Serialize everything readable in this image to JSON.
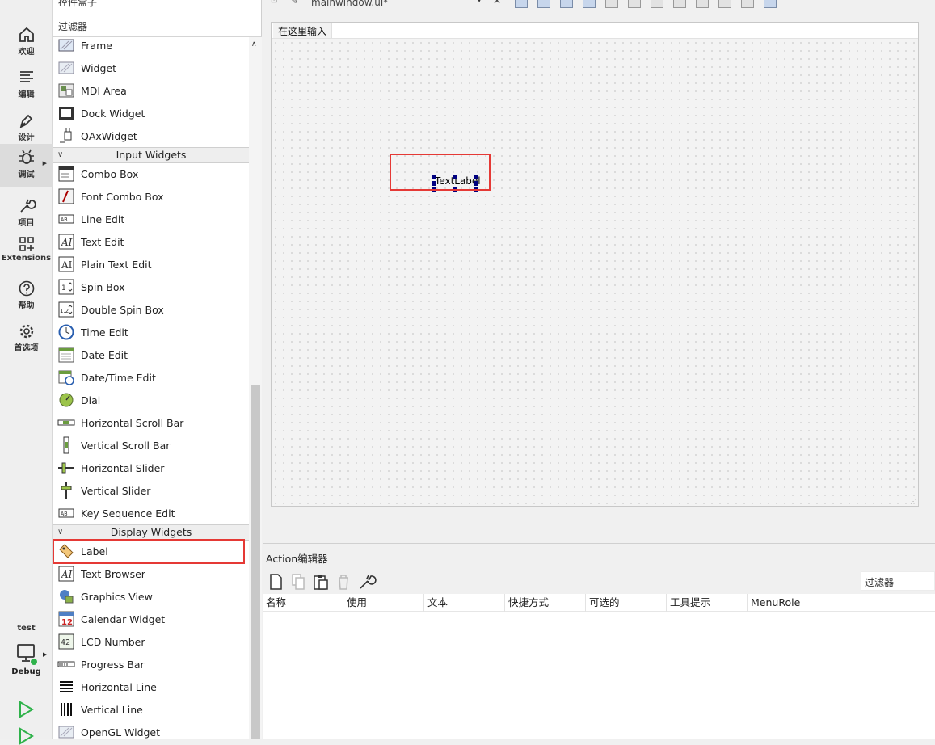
{
  "modebar": {
    "items": [
      {
        "label": "欢迎",
        "icon": "home-icon"
      },
      {
        "label": "编辑",
        "icon": "edit-lines-icon"
      },
      {
        "label": "设计",
        "icon": "pen-icon"
      },
      {
        "label": "调试",
        "icon": "bug-icon",
        "active": true
      },
      {
        "label": "项目",
        "icon": "wrench-icon"
      },
      {
        "label": "Extensions",
        "icon": "extensions-icon"
      },
      {
        "label": "帮助",
        "icon": "help-icon"
      },
      {
        "label": "首选项",
        "icon": "gear-icon"
      }
    ],
    "kit_name": "test",
    "build_config": "Debug"
  },
  "widgetbox": {
    "title": "控件盒子",
    "filter_placeholder": "过滤器",
    "top_items": [
      "Frame",
      "Widget",
      "MDI Area",
      "Dock Widget",
      "QAxWidget"
    ],
    "input_category": "Input Widgets",
    "input_items": [
      "Combo Box",
      "Font Combo Box",
      "Line Edit",
      "Text Edit",
      "Plain Text Edit",
      "Spin Box",
      "Double Spin Box",
      "Time Edit",
      "Date Edit",
      "Date/Time Edit",
      "Dial",
      "Horizontal Scroll Bar",
      "Vertical Scroll Bar",
      "Horizontal Slider",
      "Vertical Slider",
      "Key Sequence Edit"
    ],
    "display_category": "Display Widgets",
    "display_items": [
      "Label",
      "Text Browser",
      "Graphics View",
      "Calendar Widget",
      "LCD Number",
      "Progress Bar",
      "Horizontal Line",
      "Vertical Line",
      "OpenGL Widget"
    ]
  },
  "editor": {
    "document_name": "mainwindow.ui*",
    "menubar_placeholder": "在这里输入",
    "text_label": "TextLabel"
  },
  "action_editor": {
    "title": "Action编辑器",
    "filter_placeholder": "过滤器",
    "columns": [
      "名称",
      "使用",
      "文本",
      "快捷方式",
      "可选的",
      "工具提示",
      "MenuRole"
    ]
  },
  "colors": {
    "highlight": "#e53935",
    "handle": "#000080",
    "run": "#2eb24a"
  }
}
